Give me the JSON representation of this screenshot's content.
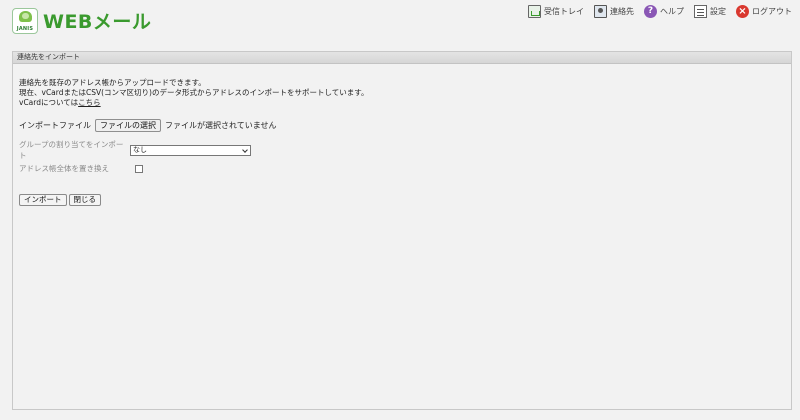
{
  "header": {
    "logo_brand": "JANIS",
    "app_title": "WEBメール",
    "nav": [
      {
        "label": "受信トレイ",
        "icon": "inbox-icon"
      },
      {
        "label": "連絡先",
        "icon": "contacts-icon"
      },
      {
        "label": "ヘルプ",
        "icon": "help-icon"
      },
      {
        "label": "設定",
        "icon": "settings-icon"
      },
      {
        "label": "ログアウト",
        "icon": "logout-icon"
      }
    ]
  },
  "panel": {
    "title": "連絡先をインポート",
    "desc_line1": "連絡先を既存のアドレス帳からアップロードできます。",
    "desc_line2": "現在、vCardまたはCSV(コンマ区切り)のデータ形式からアドレスのインポートをサポートしています。",
    "desc_line3_prefix": "vCardについては",
    "desc_line3_link": "こちら",
    "file_label": "インポートファイル",
    "file_button": "ファイルの選択",
    "file_status": "ファイルが選択されていません",
    "group_label": "グループの割り当てをインポート",
    "group_value": "なし",
    "replace_label": "アドレス帳全体を置き換え",
    "replace_checked": false,
    "import_button": "インポート",
    "close_button": "閉じる"
  }
}
